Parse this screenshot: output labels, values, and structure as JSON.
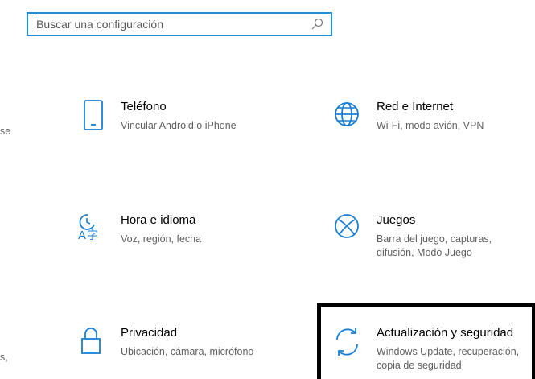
{
  "search": {
    "placeholder": "Buscar una configuración"
  },
  "left_edge": {
    "row1": "se",
    "row3": "s,"
  },
  "settings": [
    {
      "title": "Teléfono",
      "description": "Vincular Android o iPhone",
      "icon": "phone-icon"
    },
    {
      "title": "Red e Internet",
      "description": "Wi-Fi, modo avión, VPN",
      "icon": "globe-icon"
    },
    {
      "title": "Hora e idioma",
      "description": "Voz, región, fecha",
      "icon": "time-language-icon"
    },
    {
      "title": "Juegos",
      "description": "Barra del juego, capturas, difusión, Modo Juego",
      "icon": "xbox-icon"
    },
    {
      "title": "Privacidad",
      "description": "Ubicación, cámara, micrófono",
      "icon": "lock-icon"
    },
    {
      "title": "Actualización y seguridad",
      "description": "Windows Update, recuperación, copia de seguridad",
      "icon": "sync-icon"
    }
  ],
  "colors": {
    "accent": "#1f8fdc",
    "icon": "#1a7fd4",
    "description": "#5f5f5f",
    "highlight_border": "#000000"
  }
}
